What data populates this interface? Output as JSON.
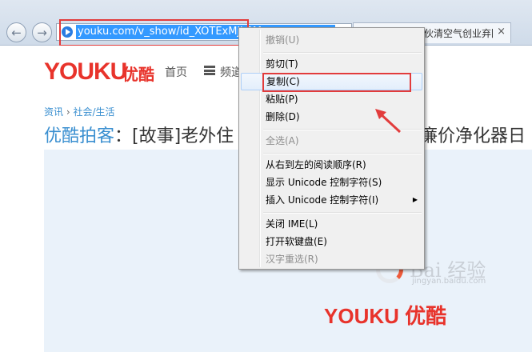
{
  "browser": {
    "back_icon": "back-arrow-icon",
    "forward_icon": "forward-arrow-icon",
    "address_url": "youku.com/v_show/id_XOTExMjk3M",
    "reload_icon": "reload-icon",
    "tab_title": "北京:外籍小伙清空气创业弃回...",
    "tab_close": "×"
  },
  "page": {
    "logo": "YOUKU",
    "logo_cn": "优酷",
    "nav_home": "首页",
    "nav_channel": "频道",
    "breadcrumb_a": "资讯",
    "breadcrumb_sep": " › ",
    "breadcrumb_b": "社会/生活",
    "title_prefix": "优酷拍客",
    "title_main": "：[故事]老外住",
    "title_tail": "廉价净化器日",
    "player_logo": "YOUKU 优酷",
    "watermark": "Bai 经验",
    "watermark_sub": "jingyan.baidu.com"
  },
  "context_menu": {
    "items": [
      {
        "label": "撤销(U)",
        "disabled": true
      },
      {
        "label": "剪切(T)",
        "disabled": false
      },
      {
        "label": "复制(C)",
        "disabled": false
      },
      {
        "label": "粘贴(P)",
        "disabled": false
      },
      {
        "label": "删除(D)",
        "disabled": false
      },
      {
        "label": "全选(A)",
        "disabled": true
      },
      {
        "label": "从右到左的阅读顺序(R)",
        "disabled": false
      },
      {
        "label": "显示 Unicode 控制字符(S)",
        "disabled": false
      },
      {
        "label": "插入 Unicode 控制字符(I)",
        "disabled": false
      },
      {
        "label": "关闭 IME(L)",
        "disabled": false
      },
      {
        "label": "打开软键盘(E)",
        "disabled": false
      },
      {
        "label": "汉字重选(R)",
        "disabled": true
      }
    ],
    "submenu_arrow": "▶"
  },
  "colors": {
    "annotation_red": "#e23c3c",
    "youku_red": "#e8332b",
    "link_blue": "#3a8fd0",
    "selection_blue": "#3399ff"
  }
}
